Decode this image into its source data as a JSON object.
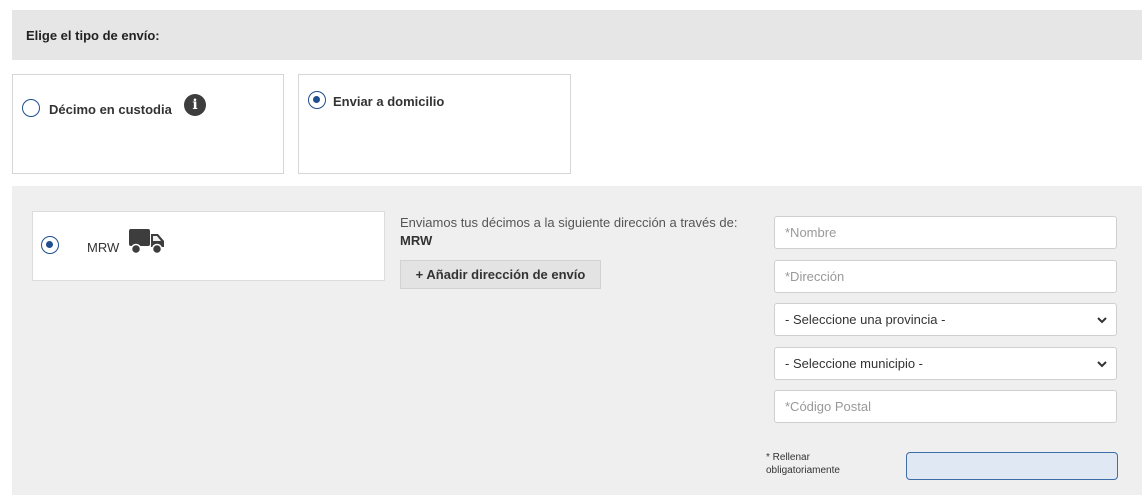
{
  "header": {
    "title": "Elige el tipo de envío:"
  },
  "options": {
    "custodia": {
      "label": "Décimo en custodia",
      "selected": false,
      "icon": "info-icon"
    },
    "domicilio": {
      "label": "Enviar a domicilio",
      "selected": true
    }
  },
  "carrier": {
    "label": "MRW",
    "icon": "truck-icon",
    "selected": true
  },
  "shipping_text": {
    "prefix": "Enviamos tus décimos a la siguiente dirección a través de:",
    "carrier": "MRW"
  },
  "add_address_button": "+ Añadir dirección de envío",
  "form": {
    "nombre_placeholder": "*Nombre",
    "direccion_placeholder": "*Dirección",
    "provincia_selected": "- Seleccione una provincia -",
    "municipio_selected": "- Seleccione municipio -",
    "codigo_postal_placeholder": "*Código Postal"
  },
  "required_note": "* Rellenar obligatoriamente",
  "colors": {
    "accent": "#1f4f8f",
    "header_bg": "#e6e6e6",
    "panel_bg": "#efefef"
  }
}
